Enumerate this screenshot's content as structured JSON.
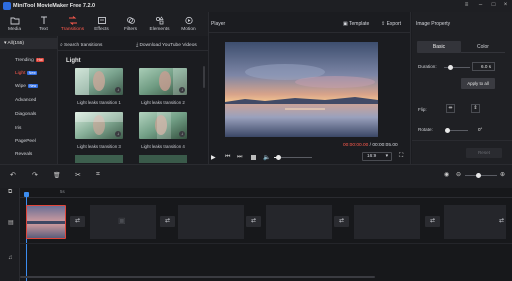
{
  "app": {
    "title": "MiniTool MovieMaker Free 7.2.0"
  },
  "toolbar": {
    "items": [
      {
        "label": "Media",
        "icon": "folder-icon"
      },
      {
        "label": "Text",
        "icon": "text-icon"
      },
      {
        "label": "Transitions",
        "icon": "transitions-icon",
        "active": true
      },
      {
        "label": "Effects",
        "icon": "effects-icon"
      },
      {
        "label": "Filters",
        "icon": "filters-icon"
      },
      {
        "label": "Elements",
        "icon": "elements-icon"
      },
      {
        "label": "Motion",
        "icon": "motion-icon"
      }
    ]
  },
  "nav": {
    "all_label": "All(155)",
    "items": [
      {
        "label": "Trending",
        "badge": "Hot"
      },
      {
        "label": "Light",
        "badge": "New",
        "active": true
      },
      {
        "label": "Wipe",
        "badge": "New"
      },
      {
        "label": "Advanced"
      },
      {
        "label": "Diagonals"
      },
      {
        "label": "Iris"
      },
      {
        "label": "PagePeel"
      },
      {
        "label": "Reveals"
      }
    ]
  },
  "content": {
    "search_label": "Search transitions",
    "download_label": "Download YouTube Videos",
    "section_title": "Light",
    "thumbs": [
      "Light leaks transition 1",
      "Light leaks transition 2",
      "Light leaks transition 3",
      "Light leaks transition 4"
    ]
  },
  "player": {
    "title": "Player",
    "template_label": "Template",
    "export_label": "Export",
    "time_current": "00:00:00.00",
    "time_sep": " / ",
    "time_total": "00:00:05.00",
    "zoom": "16:9"
  },
  "property": {
    "title": "Image Property",
    "tabs": [
      "Basic",
      "Color"
    ],
    "duration_label": "Duration:",
    "duration_value": "6.0 s",
    "apply_all": "Apply to all",
    "flip_label": "Flip:",
    "rotate_label": "Rotate:",
    "rotate_value": "0°",
    "reset_label": "Reset"
  },
  "timeline": {
    "ruler_mark": "5s"
  },
  "colors": {
    "accent": "#ff5a4d",
    "blue": "#3470e4",
    "panel": "#1f2024"
  }
}
